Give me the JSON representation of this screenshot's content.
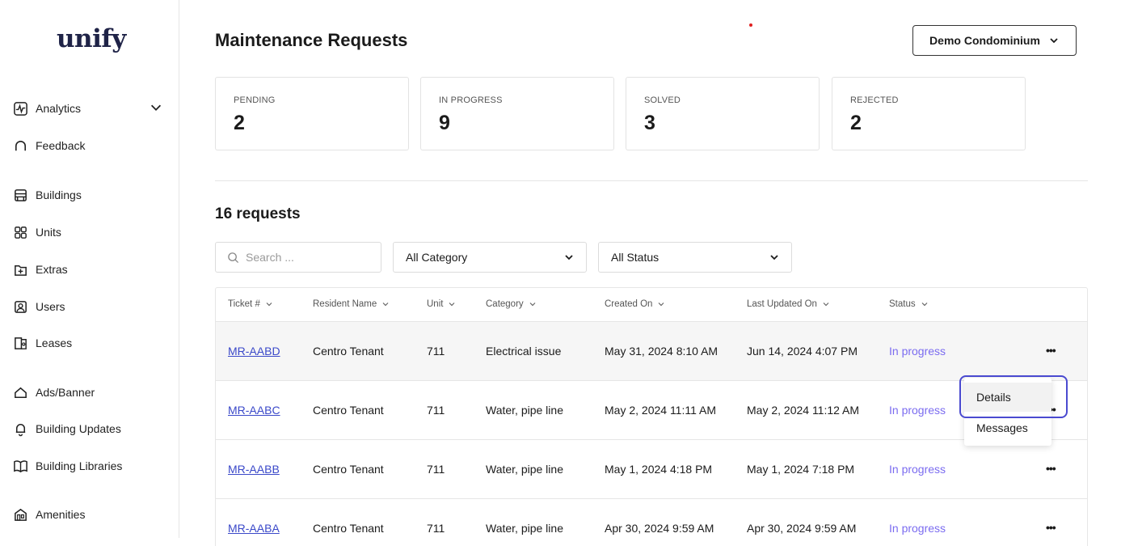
{
  "sidebar": {
    "logo": "unify",
    "items": [
      {
        "label": "Analytics",
        "icon": "analytics-icon"
      },
      {
        "label": "Feedback",
        "icon": "feedback-icon"
      },
      {
        "label": "Buildings",
        "icon": "buildings-icon"
      },
      {
        "label": "Units",
        "icon": "units-icon"
      },
      {
        "label": "Extras",
        "icon": "extras-icon"
      },
      {
        "label": "Users",
        "icon": "users-icon"
      },
      {
        "label": "Leases",
        "icon": "leases-icon"
      },
      {
        "label": "Ads/Banner",
        "icon": "ads-banner-icon"
      },
      {
        "label": "Building Updates",
        "icon": "bell-icon"
      },
      {
        "label": "Building Libraries",
        "icon": "book-icon"
      },
      {
        "label": "Amenities",
        "icon": "amenities-icon"
      }
    ]
  },
  "header": {
    "title": "Maintenance Requests",
    "building_select": "Demo Condominium"
  },
  "stats": [
    {
      "label": "PENDING",
      "value": "2"
    },
    {
      "label": "IN PROGRESS",
      "value": "9"
    },
    {
      "label": "SOLVED",
      "value": "3"
    },
    {
      "label": "REJECTED",
      "value": "2"
    }
  ],
  "requests": {
    "count_label": "16 requests",
    "search_placeholder": "Search ...",
    "category_filter": "All Category",
    "status_filter": "All Status",
    "columns": [
      "Ticket #",
      "Resident Name",
      "Unit",
      "Category",
      "Created On",
      "Last Updated On",
      "Status"
    ],
    "rows": [
      {
        "ticket": "MR-AABD",
        "resident": "Centro Tenant",
        "unit": "711",
        "category": "Electrical issue",
        "created": "May 31, 2024 8:10 AM",
        "updated": "Jun 14, 2024 4:07 PM",
        "status": "In progress"
      },
      {
        "ticket": "MR-AABC",
        "resident": "Centro Tenant",
        "unit": "711",
        "category": "Water, pipe line",
        "created": "May 2, 2024 11:11 AM",
        "updated": "May 2, 2024 11:12 AM",
        "status": "In progress"
      },
      {
        "ticket": "MR-AABB",
        "resident": "Centro Tenant",
        "unit": "711",
        "category": "Water, pipe line",
        "created": "May 1, 2024 4:18 PM",
        "updated": "May 1, 2024 7:18 PM",
        "status": "In progress"
      },
      {
        "ticket": "MR-AABA",
        "resident": "Centro Tenant",
        "unit": "711",
        "category": "Water, pipe line",
        "created": "Apr 30, 2024 9:59 AM",
        "updated": "Apr 30, 2024 9:59 AM",
        "status": "In progress"
      }
    ],
    "more_label": "•••",
    "more_label_partial": "••"
  },
  "context_menu": {
    "items": [
      "Details",
      "Messages"
    ]
  },
  "colors": {
    "link": "#3b49c9",
    "status": "#7b6cf0",
    "highlight": "#4a4ad0",
    "logo": "#1f2347"
  }
}
